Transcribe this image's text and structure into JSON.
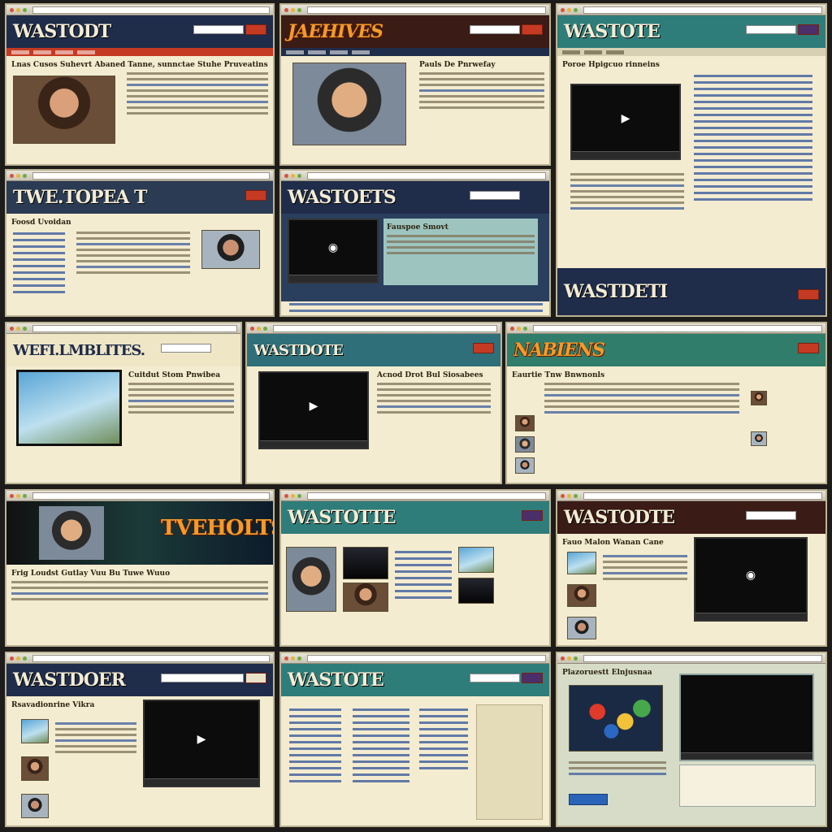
{
  "collage": {
    "tiles": [
      {
        "id": "t1",
        "logo": "WASTODT",
        "headline": "Lnas Cusos Suhevrt Abaned Tanne, sunnctae Stuhe Pruveatins"
      },
      {
        "id": "t2",
        "logo": "JAEHIVES",
        "headline": "Pauls De Pnrwefay"
      },
      {
        "id": "t3",
        "logo": "WASTOTE",
        "headline": "Poroe Hpigcuo rinneins"
      },
      {
        "id": "t4",
        "logo": "TWE.TOPEA T",
        "headline": "Foosd Uvoidan"
      },
      {
        "id": "t5",
        "logo": "WASTOETS",
        "headline": "Fauspoe Smovt"
      },
      {
        "id": "t6",
        "logo": "WASTDETI",
        "headline": ""
      },
      {
        "id": "t7",
        "logo": "WEFI.LMBLITES.",
        "headline": "Cuitdut Stom Pnwibea"
      },
      {
        "id": "t8",
        "logo": "WASTDOTE",
        "headline": "Acnod Drot Bul Siosabees"
      },
      {
        "id": "t9",
        "logo": "NABIENS",
        "headline": "Eaurtie Tnw Bnwnonls"
      },
      {
        "id": "t10",
        "logo": "TVEHOLTS",
        "headline": "Frig Loudst Gutlay Vuu Bu Tuwe Wuuo"
      },
      {
        "id": "t11",
        "logo": "WASTOTTE",
        "headline": ""
      },
      {
        "id": "t12",
        "logo": "WASTODTE",
        "headline": "Fauo Malon Wanan Cane"
      },
      {
        "id": "t13",
        "logo": "WASTDOER",
        "headline": "Rsavadionrine Vikra"
      },
      {
        "id": "t14",
        "logo": "WASTOTE",
        "headline": ""
      },
      {
        "id": "t15",
        "logo": "",
        "headline": "Plazoruestt Elnjusnaa"
      }
    ]
  },
  "colors": {
    "navy": "#1f2c4a",
    "teal": "#2f7d7a",
    "dark_red": "#3a1b15",
    "paper": "#f4ecd0",
    "accent_red": "#c53a22"
  }
}
